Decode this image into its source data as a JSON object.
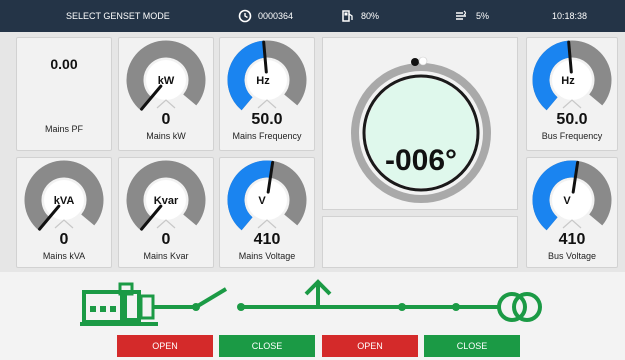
{
  "topbar": {
    "mode_label": "SELECT GENSET MODE",
    "hours": "0000364",
    "fuel": "80%",
    "exhaust": "5%",
    "time": "10:18:38"
  },
  "colors": {
    "topbar": "#243447",
    "gauge_active": "#1a84f0",
    "gauge_inactive": "#8a8a8a",
    "bus": "#1b9a45",
    "open_button": "#d42a2a",
    "close_button": "#1b9a45",
    "sync_face": "#dff8ec"
  },
  "mains": {
    "pf": {
      "title": "Mains PF",
      "value": "0.00"
    },
    "kw": {
      "title": "Mains kW",
      "value": "0",
      "unit": "kW",
      "fraction": 0
    },
    "frequency": {
      "title": "Mains Frequency",
      "value": "50.0",
      "unit": "Hz",
      "fraction": 0.5
    },
    "kva": {
      "title": "Mains kVA",
      "value": "0",
      "unit": "kVA",
      "fraction": 0
    },
    "kvar": {
      "title": "Mains Kvar",
      "value": "0",
      "unit": "Kvar",
      "fraction": 0
    },
    "voltage": {
      "title": "Mains Voltage",
      "value": "410",
      "unit": "V",
      "fraction": 0.55
    }
  },
  "sync": {
    "phase": "-006°"
  },
  "bus": {
    "frequency": {
      "title": "Bus Frequency",
      "value": "50.0",
      "unit": "Hz",
      "fraction": 0.5
    },
    "voltage": {
      "title": "Bus Voltage",
      "value": "410",
      "unit": "V",
      "fraction": 0.55
    }
  },
  "buttons": {
    "genset_breaker_open": "OPEN",
    "genset_breaker_close": "CLOSE",
    "mains_breaker_open": "OPEN",
    "mains_breaker_close": "CLOSE"
  }
}
